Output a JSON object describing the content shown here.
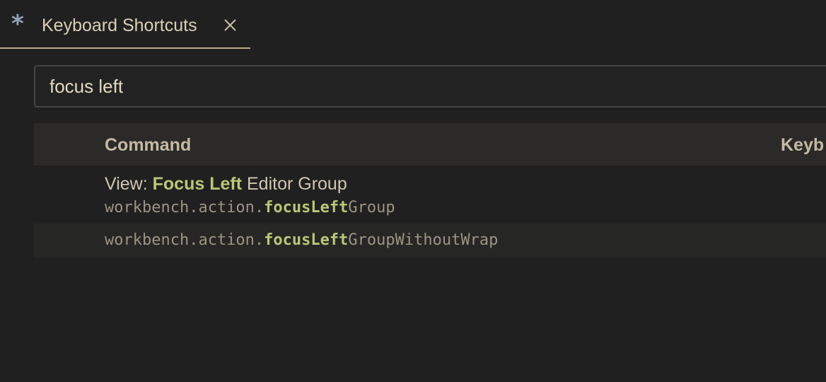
{
  "tab": {
    "icon": "asterisk-icon",
    "title": "Keyboard Shortcuts",
    "close_icon": "close-icon"
  },
  "search": {
    "value": "focus left"
  },
  "table": {
    "headers": {
      "command": "Command",
      "keybinding": "Keyb"
    },
    "rows": [
      {
        "title_prefix": "View: ",
        "title_match": "Focus Left",
        "title_suffix": " Editor Group",
        "id_prefix": "workbench.action.",
        "id_match": "focusLeft",
        "id_suffix": "Group"
      },
      {
        "id_prefix": "workbench.action.",
        "id_match": "focusLeft",
        "id_suffix": "GroupWithoutWrap"
      }
    ]
  },
  "colors": {
    "background": "#202020",
    "tab_underline": "#b8a98c",
    "match_highlight": "#b9c776",
    "header_bg": "#2b2a29"
  }
}
